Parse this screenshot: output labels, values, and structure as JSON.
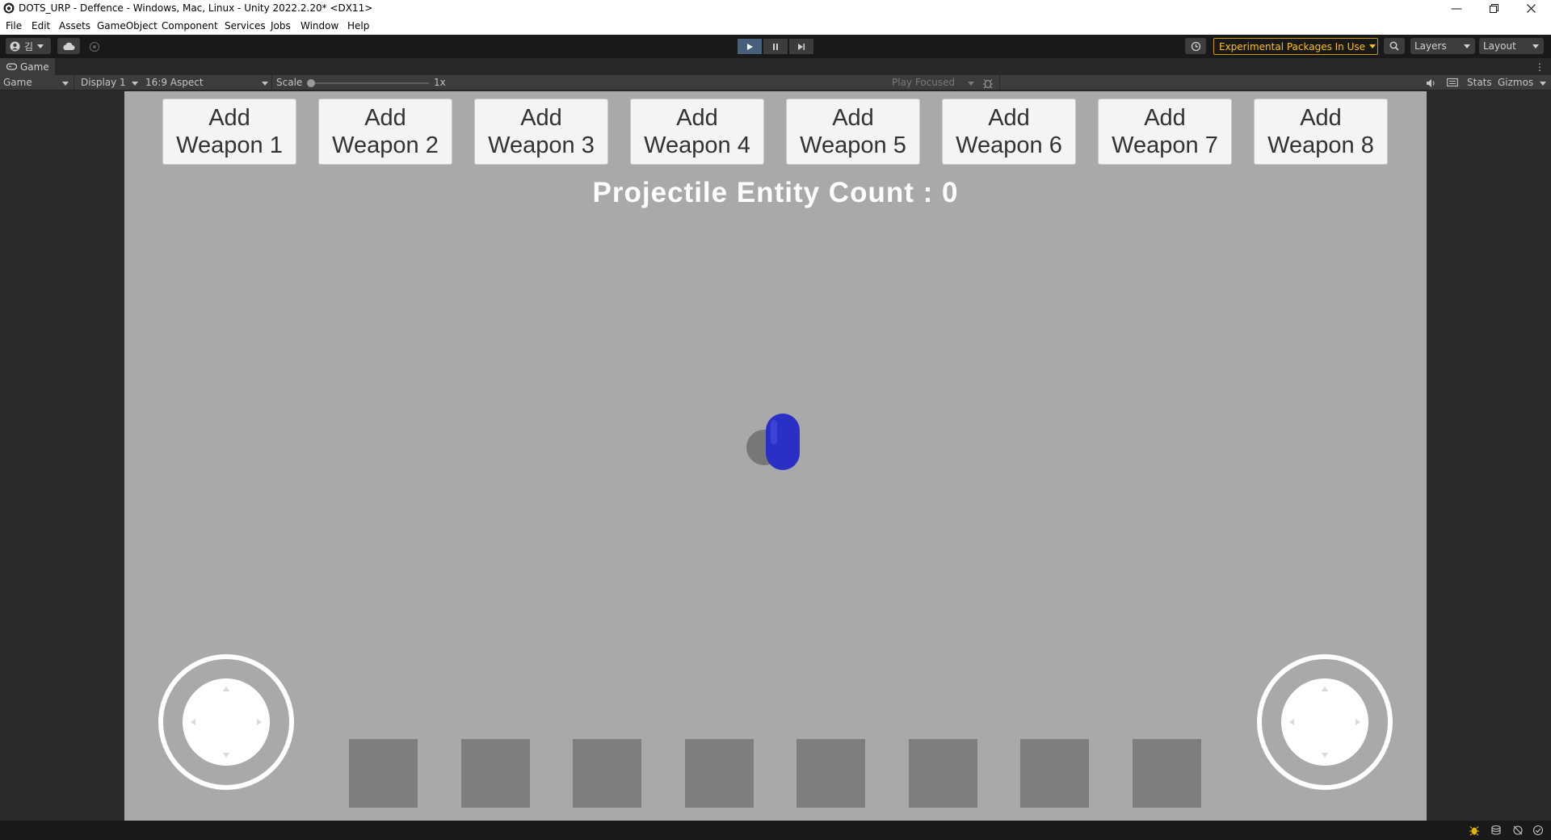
{
  "window": {
    "title": "DOTS_URP - Deffence - Windows, Mac, Linux - Unity 2022.2.20* <DX11>"
  },
  "menu": [
    "File",
    "Edit",
    "Assets",
    "GameObject",
    "Component",
    "Services",
    "Jobs",
    "Window",
    "Help"
  ],
  "toolbar": {
    "account_initial": "김",
    "experimental_label": "Experimental Packages In Use",
    "layers_label": "Layers",
    "layout_label": "Layout"
  },
  "tab": {
    "label": "Game"
  },
  "game_toolbar": {
    "view_mode": "Game",
    "display": "Display 1",
    "aspect": "16:9 Aspect",
    "scale_label": "Scale",
    "scale_value": "1x",
    "play_mode": "Play Focused",
    "stats_label": "Stats",
    "gizmos_label": "Gizmos"
  },
  "game": {
    "weapon_buttons": [
      "Add\nWeapon 1",
      "Add\nWeapon 2",
      "Add\nWeapon 3",
      "Add\nWeapon 4",
      "Add\nWeapon 5",
      "Add\nWeapon 6",
      "Add\nWeapon 7",
      "Add\nWeapon 8"
    ],
    "entity_count_label": "Projectile Entity Count : ",
    "entity_count_value": "0",
    "player_color": "#2a2fc6",
    "slot_count": 8
  },
  "colors": {
    "viewport_bg": "#a9a9a9",
    "accent_warning": "#ffc107",
    "play_active": "#46607c"
  }
}
